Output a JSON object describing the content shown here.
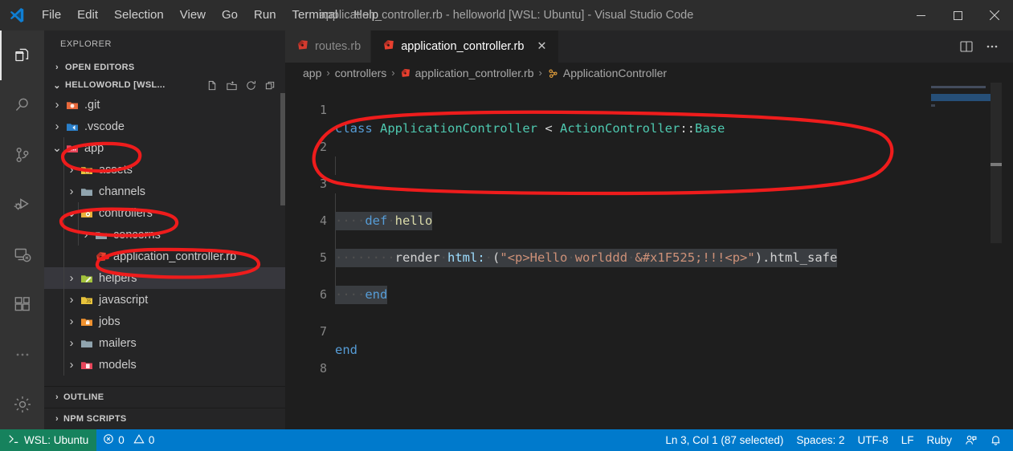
{
  "window": {
    "title": "application_controller.rb - helloworld [WSL: Ubuntu] - Visual Studio Code",
    "minimize_label": "─",
    "maximize_label": "☐",
    "close_label": "✕"
  },
  "menu": {
    "items": [
      {
        "label": "File"
      },
      {
        "label": "Edit"
      },
      {
        "label": "Selection"
      },
      {
        "label": "View"
      },
      {
        "label": "Go"
      },
      {
        "label": "Run"
      },
      {
        "label": "Terminal"
      },
      {
        "label": "Help"
      }
    ]
  },
  "activity_bar": {
    "items": [
      {
        "name": "explorer-icon",
        "active": true
      },
      {
        "name": "search-icon",
        "active": false
      },
      {
        "name": "source-control-icon",
        "active": false
      },
      {
        "name": "run-and-debug-icon",
        "active": false
      },
      {
        "name": "remote-explorer-icon",
        "active": false
      },
      {
        "name": "extensions-icon",
        "active": false
      },
      {
        "name": "more-actions-icon",
        "active": false
      },
      {
        "name": "manage-settings-gear-icon",
        "active": false
      }
    ]
  },
  "sidebar": {
    "title": "EXPLORER",
    "open_editors_label": "OPEN EDITORS",
    "folder_label": "HELLOWORLD [WSL...",
    "folder_actions": [
      "new-file-icon",
      "new-folder-icon",
      "refresh-icon",
      "collapse-all-icon"
    ],
    "tree": [
      {
        "label": ".git",
        "depth": 1,
        "arrow": "›",
        "icon": "git-folder",
        "selected": false
      },
      {
        "label": ".vscode",
        "depth": 1,
        "arrow": "›",
        "icon": "vscode-folder",
        "selected": false
      },
      {
        "label": "app",
        "depth": 1,
        "arrow": "⌄",
        "icon": "app-folder",
        "selected": false
      },
      {
        "label": "assets",
        "depth": 2,
        "arrow": "›",
        "icon": "assets-folder",
        "selected": false
      },
      {
        "label": "channels",
        "depth": 2,
        "arrow": "›",
        "icon": "plain-folder",
        "selected": false
      },
      {
        "label": "controllers",
        "depth": 2,
        "arrow": "⌄",
        "icon": "controllers-folder",
        "selected": false
      },
      {
        "label": "concerns",
        "depth": 3,
        "arrow": "›",
        "icon": "plain-folder",
        "selected": false
      },
      {
        "label": "application_controller.rb",
        "depth": 3,
        "arrow": "",
        "icon": "ruby-file",
        "selected": false
      },
      {
        "label": "helpers",
        "depth": 2,
        "arrow": "›",
        "icon": "helpers-folder",
        "selected": true
      },
      {
        "label": "javascript",
        "depth": 2,
        "arrow": "›",
        "icon": "js-folder",
        "selected": false
      },
      {
        "label": "jobs",
        "depth": 2,
        "arrow": "›",
        "icon": "jobs-folder",
        "selected": false
      },
      {
        "label": "mailers",
        "depth": 2,
        "arrow": "›",
        "icon": "plain-folder",
        "selected": false
      },
      {
        "label": "models",
        "depth": 2,
        "arrow": "›",
        "icon": "models-folder",
        "selected": false
      }
    ],
    "bottom_sections": [
      {
        "label": "OUTLINE"
      },
      {
        "label": "NPM SCRIPTS"
      }
    ]
  },
  "editor": {
    "tabs": [
      {
        "label": "routes.rb",
        "icon": "ruby-file",
        "active": false,
        "closable": false
      },
      {
        "label": "application_controller.rb",
        "icon": "ruby-file",
        "active": true,
        "closable": true,
        "close_label": "✕"
      }
    ],
    "tab_actions": [
      "split-editor-icon",
      "more-actions-icon"
    ],
    "breadcrumbs": [
      {
        "label": "app",
        "icon": ""
      },
      {
        "label": "controllers",
        "icon": ""
      },
      {
        "label": "application_controller.rb",
        "icon": "ruby-file"
      },
      {
        "label": "ApplicationController",
        "icon": "class-symbol"
      }
    ],
    "breadcrumb_separator": "›",
    "lines": [
      {
        "num": "1",
        "text": "class ApplicationController < ActionController::Base"
      },
      {
        "num": "2",
        "text": ""
      },
      {
        "num": "3",
        "text": "    def hello"
      },
      {
        "num": "4",
        "text": "        render html: (\"<p>Hello worlddd &#x1F525;!!!<p>\").html_safe"
      },
      {
        "num": "5",
        "text": "    end"
      },
      {
        "num": "6",
        "text": ""
      },
      {
        "num": "7",
        "text": "end"
      },
      {
        "num": "8",
        "text": ""
      }
    ]
  },
  "status_bar": {
    "remote_label": "WSL: Ubuntu",
    "errors": "0",
    "warnings": "0",
    "cursor_position": "Ln 3, Col 1 (87 selected)",
    "indentation": "Spaces: 2",
    "encoding": "UTF-8",
    "eol": "LF",
    "language": "Ruby",
    "feedback_icon": "send-feedback-icon",
    "notifications_icon": "bell-icon"
  },
  "colors": {
    "accent": "#007acc",
    "remote_green": "#16825d",
    "annotation_red": "#ee1c1c",
    "editor_bg": "#1e1e1e",
    "sidebar_bg": "#252526",
    "activitybar_bg": "#333333",
    "titlebar_bg": "#2d2d2d"
  },
  "annotations": {
    "shapes": [
      {
        "name": "circle-around-app-folder"
      },
      {
        "name": "circle-around-controllers-folder"
      },
      {
        "name": "circle-around-application-controller-file"
      },
      {
        "name": "circle-around-hello-method-code"
      }
    ]
  }
}
